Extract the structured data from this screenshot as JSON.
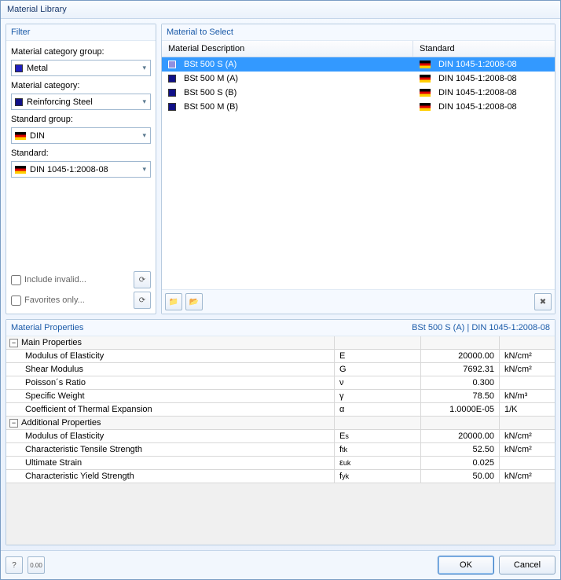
{
  "window": {
    "title": "Material Library"
  },
  "filter": {
    "title": "Filter",
    "cat_group_label": "Material category group:",
    "cat_group_value": "Metal",
    "cat_label": "Material category:",
    "cat_value": "Reinforcing Steel",
    "std_group_label": "Standard group:",
    "std_group_value": "DIN",
    "std_label": "Standard:",
    "std_value": "DIN 1045-1:2008-08",
    "include_invalid": "Include invalid...",
    "favorites_only": "Favorites only..."
  },
  "select": {
    "title": "Material to Select",
    "col_desc": "Material Description",
    "col_std": "Standard",
    "rows": [
      {
        "desc": "BSt 500 S (A)",
        "std": "DIN 1045-1:2008-08",
        "selected": true
      },
      {
        "desc": "BSt 500 M (A)",
        "std": "DIN 1045-1:2008-08",
        "selected": false
      },
      {
        "desc": "BSt 500 S (B)",
        "std": "DIN 1045-1:2008-08",
        "selected": false
      },
      {
        "desc": "BSt 500 M (B)",
        "std": "DIN 1045-1:2008-08",
        "selected": false
      }
    ]
  },
  "props": {
    "title": "Material Properties",
    "context": "BSt 500 S (A)  |  DIN 1045-1:2008-08",
    "main_section": "Main Properties",
    "add_section": "Additional Properties",
    "rows_main": [
      {
        "name": "Modulus of Elasticity",
        "sym": "E",
        "val": "20000.00",
        "unit": "kN/cm²"
      },
      {
        "name": "Shear Modulus",
        "sym": "G",
        "val": "7692.31",
        "unit": "kN/cm²"
      },
      {
        "name": "Poisson´s Ratio",
        "sym": "ν",
        "val": "0.300",
        "unit": ""
      },
      {
        "name": "Specific Weight",
        "sym": "γ",
        "val": "78.50",
        "unit": "kN/m³"
      },
      {
        "name": "Coefficient of Thermal Expansion",
        "sym": "α",
        "val": "1.0000E-05",
        "unit": "1/K"
      }
    ],
    "rows_add": [
      {
        "name": "Modulus of Elasticity",
        "sym_html": "E<sub>s</sub>",
        "val": "20000.00",
        "unit": "kN/cm²"
      },
      {
        "name": "Characteristic Tensile Strength",
        "sym_html": "f<sub>tk</sub>",
        "val": "52.50",
        "unit": "kN/cm²"
      },
      {
        "name": "Ultimate Strain",
        "sym_html": "ε<sub>uk</sub>",
        "val": "0.025",
        "unit": ""
      },
      {
        "name": "Characteristic Yield Strength",
        "sym_html": "f<sub>yk</sub>",
        "val": "50.00",
        "unit": "kN/cm²"
      }
    ]
  },
  "footer": {
    "ok": "OK",
    "cancel": "Cancel"
  }
}
